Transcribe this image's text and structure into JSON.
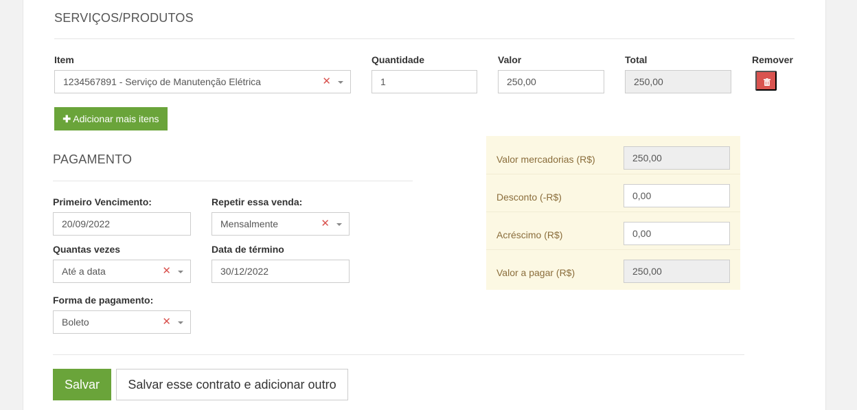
{
  "services": {
    "title": "SERVIÇOS/PRODUTOS",
    "columns": {
      "item": "Item",
      "quantity": "Quantidade",
      "value": "Valor",
      "total": "Total",
      "remove": "Remover"
    },
    "row": {
      "item": "1234567891 - Serviço de Manutenção Elétrica",
      "quantity": "1",
      "value": "250,00",
      "total": "250,00"
    },
    "add_button": "Adicionar mais itens"
  },
  "payment": {
    "title": "PAGAMENTO",
    "first_due_label": "Primeiro Vencimento:",
    "first_due_value": "20/09/2022",
    "repeat_label": "Repetir essa venda:",
    "repeat_value": "Mensalmente",
    "times_label": "Quantas vezes",
    "times_value": "Até a data",
    "end_date_label": "Data de término",
    "end_date_value": "30/12/2022",
    "method_label": "Forma de pagamento:",
    "method_value": "Boleto"
  },
  "summary": {
    "goods_label": "Valor mercadorias (R$)",
    "goods_value": "250,00",
    "discount_label": "Desconto (-R$)",
    "discount_value": "0,00",
    "surcharge_label": "Acréscimo (R$)",
    "surcharge_value": "0,00",
    "total_label": "Valor a pagar (R$)",
    "total_value": "250,00"
  },
  "actions": {
    "save": "Salvar",
    "save_and_new": "Salvar esse contrato e adicionar outro"
  },
  "colors": {
    "primary_green": "#6aa43a",
    "danger_red": "#d9534f",
    "clear_x": "#d9534f",
    "summary_bg": "#fcf8e3"
  }
}
